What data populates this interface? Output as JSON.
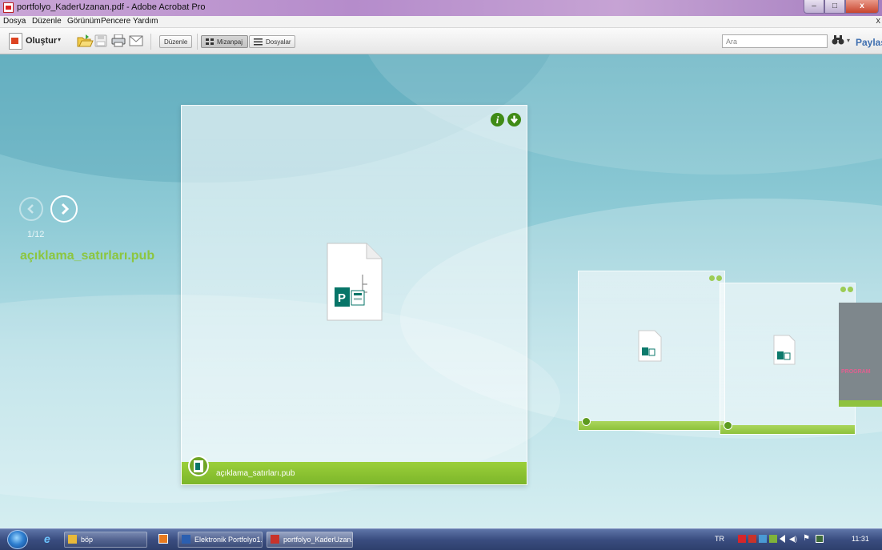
{
  "window": {
    "title": "portfolyo_KaderUzanan.pdf - Adobe Acrobat Pro",
    "buttons": {
      "minimize": "–",
      "maximize": "□",
      "close": "x"
    }
  },
  "menu": {
    "items": [
      "Dosya",
      "Düzenle",
      "Görünüm",
      "Pencere",
      "Yardım"
    ],
    "close_glyph": "x"
  },
  "toolbar": {
    "create_label": "Oluştur",
    "caret": "▾",
    "edit_label": "Düzenle",
    "layout_label": "Mizanpaj",
    "files_label": "Dosyalar",
    "search_placeholder": "Ara",
    "share_label": "Paylaş"
  },
  "portfolio": {
    "counter": "1/12",
    "current_file": "açıklama_satırları.pub",
    "card_label": "açıklama_satırları.pub",
    "info_glyph": "i",
    "selected_view": "Mizanpaj"
  },
  "taskbar": {
    "items": [
      {
        "label": "böp"
      },
      {
        "label": "Elektronik Portfolyo1..."
      },
      {
        "label": "portfolyo_KaderUzan..."
      }
    ],
    "language": "TR",
    "clock": "11:31"
  },
  "colors": {
    "accent_green": "#8cc63f",
    "card_bar_green": "#7cb62a",
    "publisher_teal": "#077568",
    "share_blue": "#3f6fb0"
  }
}
